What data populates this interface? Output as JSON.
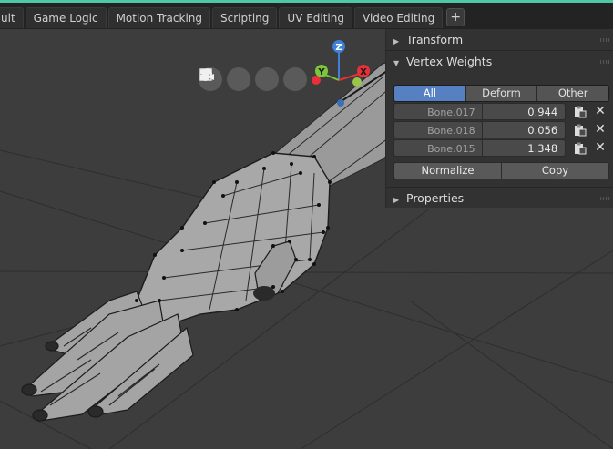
{
  "tabs": [
    "ult",
    "Game Logic",
    "Motion Tracking",
    "Scripting",
    "UV Editing",
    "Video Editing"
  ],
  "tab_add_label": "+",
  "gizmo": {
    "x_label": "X",
    "y_label": "Y",
    "z_label": "Z"
  },
  "nav_icons": [
    "grid-icon",
    "camera-icon",
    "hand-icon",
    "zoom-icon"
  ],
  "panel": {
    "transform_header": "Transform",
    "vertex_weights_header": "Vertex Weights",
    "properties_header": "Properties",
    "filter_all": "All",
    "filter_deform": "Deform",
    "filter_other": "Other",
    "weights": [
      {
        "name": "Bone.017",
        "value": "0.944"
      },
      {
        "name": "Bone.018",
        "value": "0.056"
      },
      {
        "name": "Bone.015",
        "value": "1.348"
      }
    ],
    "normalize_label": "Normalize",
    "copy_label": "Copy"
  },
  "colors": {
    "accent": "#4ec9a6",
    "active_button": "#5680c2",
    "gizmo_x": "#e8303a",
    "gizmo_y": "#7cc43a",
    "gizmo_z": "#3d82d8"
  }
}
